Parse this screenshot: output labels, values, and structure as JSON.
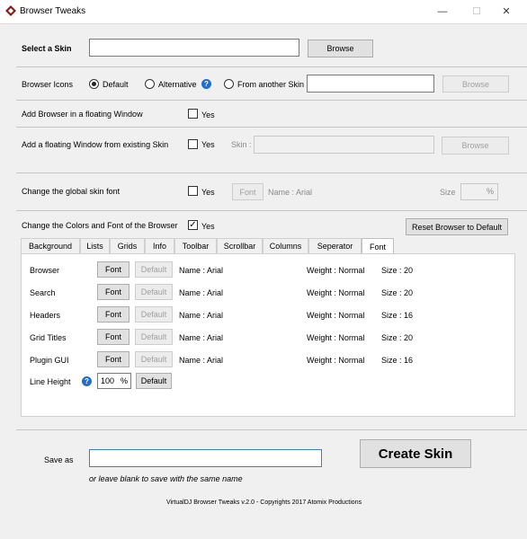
{
  "window": {
    "title": "Browser Tweaks",
    "minimize_glyph": "—",
    "maximize_glyph": "☐",
    "close_glyph": "✕",
    "icon": "app-logo-icon",
    "accent": "#8a1a1a"
  },
  "select_skin": {
    "label": "Select a Skin",
    "value": "",
    "browse_label": "Browse"
  },
  "browser_icons": {
    "label": "Browser Icons",
    "options": [
      "Default",
      "Alternative",
      "From another Skin"
    ],
    "selected": "Default",
    "help_glyph": "?",
    "path_value": "",
    "browse_label": "Browse"
  },
  "floating_window": {
    "label": "Add Browser in a floating Window",
    "checkbox_label": "Yes",
    "checked": false
  },
  "floating_existing": {
    "label": "Add a floating Window from existing Skin",
    "checkbox_label": "Yes",
    "checked": false,
    "skin_label": "Skin :",
    "skin_value": "",
    "browse_label": "Browse"
  },
  "global_font": {
    "label": "Change the global skin font",
    "checkbox_label": "Yes",
    "checked": false,
    "font_button": "Font",
    "name_text": "Name : Arial",
    "size_label": "Size",
    "size_unit": "%",
    "size_value": ""
  },
  "colors_font": {
    "label": "Change the Colors and Font of the Browser",
    "checkbox_label": "Yes",
    "checked": true,
    "reset_button": "Reset Browser to Default"
  },
  "tabs": [
    "Background",
    "Lists",
    "Grids",
    "Info",
    "Toolbar",
    "Scrollbar",
    "Columns",
    "Seperator",
    "Font"
  ],
  "active_tab": "Font",
  "font_rows": [
    {
      "label": "Browser",
      "font_button": "Font",
      "default_button": "Default",
      "name": "Name : Arial",
      "weight": "Weight : Normal",
      "size": "Size : 20"
    },
    {
      "label": "Search",
      "font_button": "Font",
      "default_button": "Default",
      "name": "Name : Arial",
      "weight": "Weight : Normal",
      "size": "Size : 20"
    },
    {
      "label": "Headers",
      "font_button": "Font",
      "default_button": "Default",
      "name": "Name : Arial",
      "weight": "Weight : Normal",
      "size": "Size : 16"
    },
    {
      "label": "Grid Titles",
      "font_button": "Font",
      "default_button": "Default",
      "name": "Name : Arial",
      "weight": "Weight : Normal",
      "size": "Size : 20"
    },
    {
      "label": "Plugin GUI",
      "font_button": "Font",
      "default_button": "Default",
      "name": "Name : Arial",
      "weight": "Weight : Normal",
      "size": "Size : 16"
    }
  ],
  "line_height": {
    "label": "Line Height",
    "help_glyph": "?",
    "value": "100",
    "unit": "%",
    "default_button": "Default"
  },
  "save": {
    "label": "Save as",
    "value": "",
    "hint": "or leave blank to save with the same name",
    "create_button": "Create Skin"
  },
  "footer": "VirtualDJ Browser Tweaks v.2.0 - Copyrights 2017 Atomix Productions"
}
